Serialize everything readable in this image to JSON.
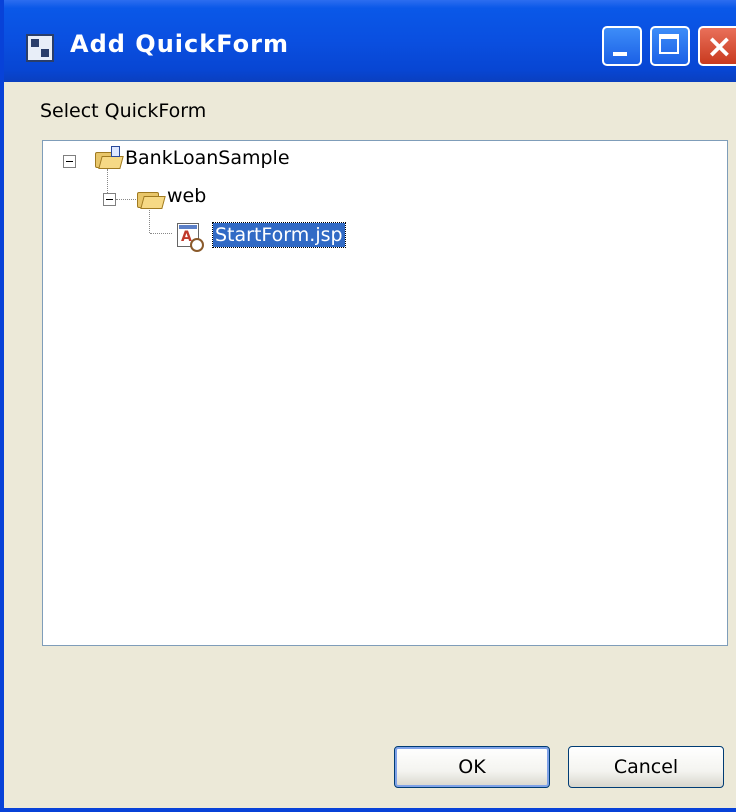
{
  "window": {
    "title": "Add QuickForm",
    "close_glyph": "×"
  },
  "dialog": {
    "label": "Select QuickForm"
  },
  "tree": {
    "project": {
      "label": "BankLoanSample",
      "icon": "project-folder-icon"
    },
    "folder": {
      "label": "web",
      "icon": "folder-icon"
    },
    "file": {
      "label": "StartForm.jsp",
      "icon": "jsp-file-icon",
      "selected": true
    }
  },
  "buttons": {
    "ok": "OK",
    "cancel": "Cancel"
  },
  "colors": {
    "titlebar": "#0A4FE0",
    "selection": "#316AC5",
    "dialog_bg": "#ECE9D8"
  }
}
